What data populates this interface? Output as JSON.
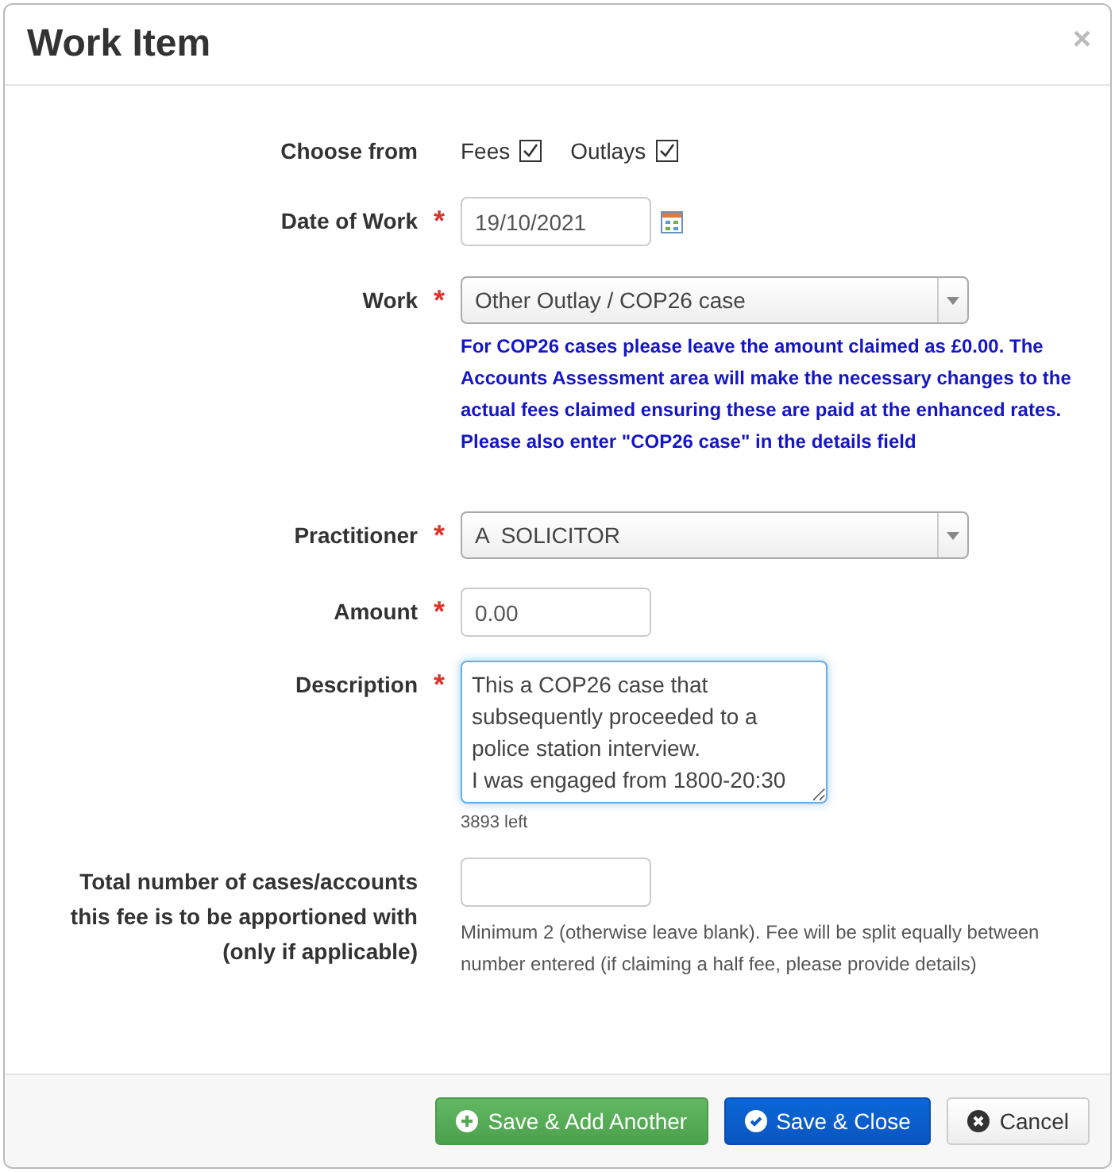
{
  "dialog": {
    "title": "Work Item",
    "close": "×"
  },
  "fields": [
    {
      "kind": "choices",
      "label": "Choose from",
      "options": [
        {
          "label": "Fees",
          "checked": true
        },
        {
          "label": "Outlays",
          "checked": true
        }
      ]
    },
    {
      "kind": "date",
      "label": "Date of Work",
      "required_mark": "*",
      "value": "19/10/2021"
    },
    {
      "kind": "select",
      "label": "Work",
      "required_mark": "*",
      "value": "Other Outlay / COP26 case",
      "note": "For COP26 cases please leave the amount claimed as £0.00. The Accounts Assessment area will make the necessary changes to the actual fees claimed ensuring these are paid at the enhanced rates. Please also enter \"COP26 case\" in the details field"
    },
    {
      "kind": "select",
      "label": "Practitioner",
      "required_mark": "*",
      "value": "A  SOLICITOR"
    },
    {
      "kind": "text",
      "label": "Amount",
      "required_mark": "*",
      "value": "0.00"
    },
    {
      "kind": "textarea",
      "label": "Description",
      "required_mark": "*",
      "value": "This a COP26 case that subsequently proceeded to a police station interview.\nI was engaged from 1800-20:30",
      "focused": true,
      "counter": "3893 left"
    },
    {
      "kind": "text",
      "label": "Total number of cases/accounts this fee is to be apportioned with (only if applicable)",
      "hint": "Minimum 2 (otherwise leave blank). Fee will be split equally between number entered (if claiming a half fee, please provide details)"
    }
  ],
  "buttons": [
    {
      "label": "Save & Add Another",
      "kind": "add"
    },
    {
      "label": "Save & Close",
      "kind": "save"
    },
    {
      "label": "Cancel",
      "kind": "cancel"
    }
  ]
}
